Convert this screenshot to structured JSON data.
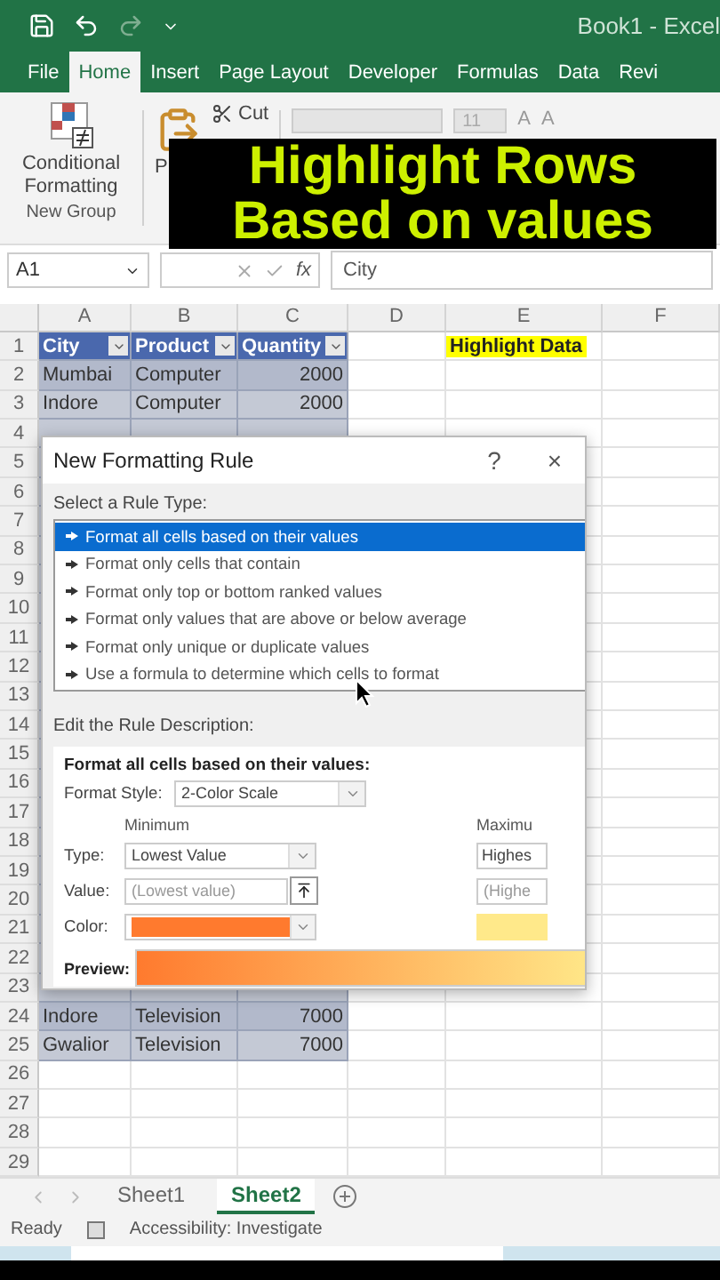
{
  "title_bar": {
    "title": "Book1  -  Excel"
  },
  "ribbon_tabs": [
    {
      "label": "File",
      "selected": false
    },
    {
      "label": "Home",
      "selected": true
    },
    {
      "label": "Insert",
      "selected": false
    },
    {
      "label": "Page Layout",
      "selected": false
    },
    {
      "label": "Developer",
      "selected": false
    },
    {
      "label": "Formulas",
      "selected": false
    },
    {
      "label": "Data",
      "selected": false
    },
    {
      "label": "Revi",
      "selected": false
    }
  ],
  "ribbon": {
    "conditional_formatting": "Conditional Formatting",
    "group_label": "New Group",
    "paste_label": "P",
    "cut_label": "Cut",
    "font_size": "11",
    "grow_label": "A",
    "shrink_label": "A"
  },
  "caption": [
    "Highlight Rows",
    "Based on values"
  ],
  "formula_bar": {
    "name_box": "A1",
    "fx": "fx",
    "value": "City"
  },
  "sheet": {
    "columns": [
      "A",
      "B",
      "C",
      "D",
      "E",
      "F"
    ],
    "rows": [
      {
        "num": "1",
        "kind": "header",
        "cells": [
          "City",
          "Product",
          "Quantity"
        ],
        "note": "Highlight Data"
      },
      {
        "num": "2",
        "kind": "data",
        "cells": [
          "Mumbai",
          "Computer",
          "2000"
        ]
      },
      {
        "num": "3",
        "kind": "data",
        "cells": [
          "Indore",
          "Computer",
          "2000"
        ]
      },
      {
        "num": "4",
        "kind": "partial"
      },
      {
        "num": "5",
        "kind": "covered"
      },
      {
        "num": "6",
        "kind": "covered"
      },
      {
        "num": "7",
        "kind": "covered"
      },
      {
        "num": "8",
        "kind": "covered"
      },
      {
        "num": "9",
        "kind": "covered"
      },
      {
        "num": "10",
        "kind": "covered"
      },
      {
        "num": "11",
        "kind": "covered"
      },
      {
        "num": "12",
        "kind": "covered"
      },
      {
        "num": "13",
        "kind": "covered"
      },
      {
        "num": "14",
        "kind": "covered"
      },
      {
        "num": "15",
        "kind": "covered"
      },
      {
        "num": "16",
        "kind": "covered"
      },
      {
        "num": "17",
        "kind": "covered"
      },
      {
        "num": "18",
        "kind": "covered"
      },
      {
        "num": "19",
        "kind": "covered"
      },
      {
        "num": "20",
        "kind": "covered"
      },
      {
        "num": "21",
        "kind": "covered"
      },
      {
        "num": "22",
        "kind": "covered"
      },
      {
        "num": "23",
        "kind": "partial"
      },
      {
        "num": "24",
        "kind": "data",
        "cells": [
          "Indore",
          "Television",
          "7000"
        ]
      },
      {
        "num": "25",
        "kind": "data",
        "cells": [
          "Gwalior",
          "Television",
          "7000"
        ]
      },
      {
        "num": "26",
        "kind": "empty"
      },
      {
        "num": "27",
        "kind": "empty"
      },
      {
        "num": "28",
        "kind": "empty"
      },
      {
        "num": "29",
        "kind": "empty"
      }
    ]
  },
  "dialog": {
    "title": "New Formatting Rule",
    "help": "?",
    "close": "×",
    "rule_type_label": "Select a Rule Type:",
    "rule_types": [
      {
        "label": "Format all cells based on their values",
        "selected": true
      },
      {
        "label": "Format only cells that contain",
        "selected": false
      },
      {
        "label": "Format only top or bottom ranked values",
        "selected": false
      },
      {
        "label": "Format only values that are above or below average",
        "selected": false
      },
      {
        "label": "Format only unique or duplicate values",
        "selected": false
      },
      {
        "label": "Use a formula to determine which cells to format",
        "selected": false
      }
    ],
    "description_label": "Edit the Rule Description:",
    "description_heading": "Format all cells based on their values:",
    "format_style": {
      "label": "Format Style:",
      "value": "2-Color Scale"
    },
    "row_labels": [
      "Type:",
      "Value:",
      "Color:"
    ],
    "minimum": {
      "heading": "Minimum",
      "type": "Lowest Value",
      "value_placeholder": "(Lowest value)",
      "color": "#ff7a2e"
    },
    "maximum": {
      "heading": "Maximu",
      "type": "Highes",
      "value_placeholder": "(Highe",
      "color": "#ffe98a"
    },
    "preview_label": "Preview:"
  },
  "sheet_tabs": [
    {
      "label": "Sheet1",
      "selected": false
    },
    {
      "label": "Sheet2",
      "selected": true
    }
  ],
  "status_bar": {
    "ready": "Ready",
    "accessibility": "Accessibility: Investigate"
  }
}
